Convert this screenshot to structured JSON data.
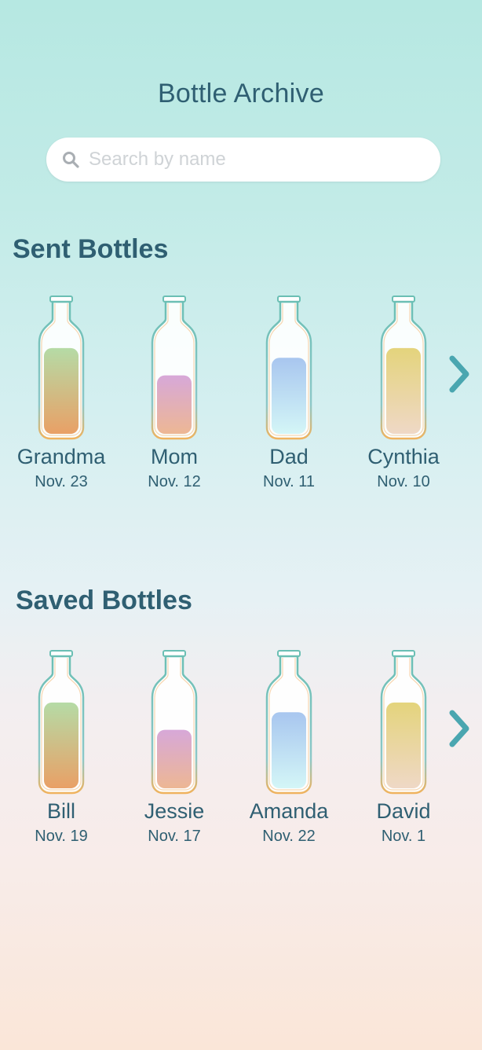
{
  "header": {
    "title": "Bottle Archive"
  },
  "search": {
    "placeholder": "Search by name",
    "value": ""
  },
  "sent": {
    "title": "Sent Bottles",
    "items": [
      {
        "name": "Grandma",
        "date": "Nov. 23",
        "fill_top": "#b5dba6",
        "fill_bottom": "#e9a066",
        "fill_level": 0.88
      },
      {
        "name": "Mom",
        "date": "Nov. 12",
        "fill_top": "#d7a8d9",
        "fill_bottom": "#edb794",
        "fill_level": 0.6
      },
      {
        "name": "Dad",
        "date": "Nov. 11",
        "fill_top": "#a8c6ef",
        "fill_bottom": "#d4f6f7",
        "fill_level": 0.78
      },
      {
        "name": "Cynthia",
        "date": "Nov. 10",
        "fill_top": "#e4d47c",
        "fill_bottom": "#efd8c6",
        "fill_level": 0.88
      }
    ]
  },
  "saved": {
    "title": "Saved Bottles",
    "items": [
      {
        "name": "Bill",
        "date": "Nov. 19",
        "fill_top": "#b5dba6",
        "fill_bottom": "#e9a066",
        "fill_level": 0.88
      },
      {
        "name": "Jessie",
        "date": "Nov. 17",
        "fill_top": "#d7a8d9",
        "fill_bottom": "#edb794",
        "fill_level": 0.6
      },
      {
        "name": "Amanda",
        "date": "Nov. 22",
        "fill_top": "#a8c6ef",
        "fill_bottom": "#d4f6f7",
        "fill_level": 0.78
      },
      {
        "name": "David",
        "date": "Nov. 1",
        "fill_top": "#e4d47c",
        "fill_bottom": "#efd8c6",
        "fill_level": 0.88
      }
    ]
  },
  "icons": {
    "search": "search-icon",
    "next": "chevron-right-icon",
    "bottle": "bottle-icon"
  },
  "colors": {
    "text": "#2f5f72",
    "bottle_outline": "#6bbfb4",
    "bottle_rim": "#f0b35e",
    "chevron": "#4aa6b0"
  }
}
